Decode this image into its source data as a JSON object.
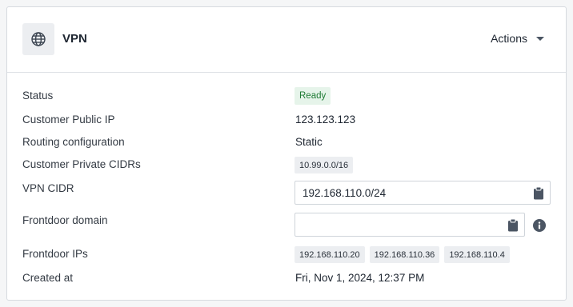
{
  "header": {
    "icon": "globe-icon",
    "title": "VPN",
    "actions_label": "Actions"
  },
  "fields": {
    "status": {
      "label": "Status",
      "value": "Ready"
    },
    "public_ip": {
      "label": "Customer Public IP",
      "value": "123.123.123"
    },
    "routing": {
      "label": "Routing configuration",
      "value": "Static"
    },
    "private_cidrs": {
      "label": "Customer Private CIDRs",
      "values": [
        "10.99.0.0/16"
      ]
    },
    "vpn_cidr": {
      "label": "VPN CIDR",
      "value": "192.168.110.0/24"
    },
    "frontdoor_domain": {
      "label": "Frontdoor domain",
      "value": ""
    },
    "frontdoor_ips": {
      "label": "Frontdoor IPs",
      "values": [
        "192.168.110.20",
        "192.168.110.36",
        "192.168.110.4"
      ]
    },
    "created_at": {
      "label": "Created at",
      "value": "Fri, Nov 1, 2024, 12:37 PM"
    }
  },
  "colors": {
    "ready_bg": "#e6f4ea",
    "ready_text": "#1e7b34",
    "tag_bg": "#eceef1"
  }
}
